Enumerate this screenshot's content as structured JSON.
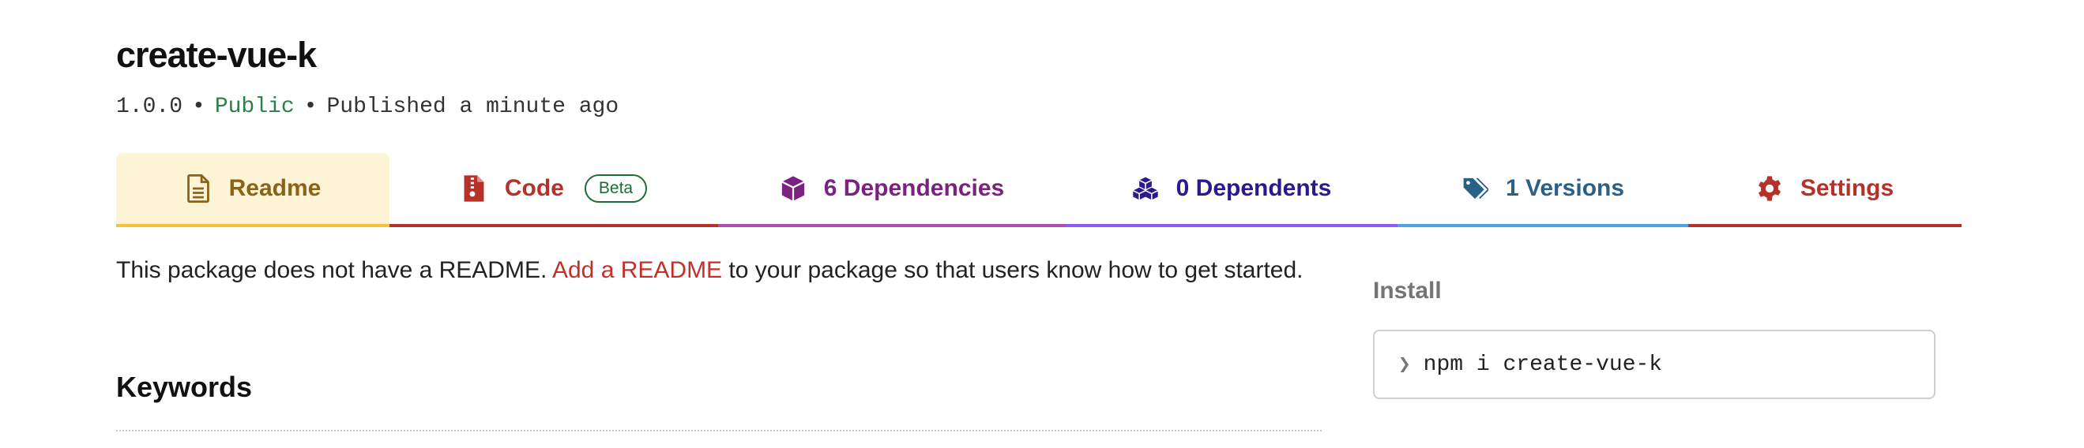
{
  "package": {
    "name": "create-vue-k",
    "version": "1.0.0",
    "separator": "•",
    "visibility": "Public",
    "published": "Published a minute ago"
  },
  "tabs": [
    {
      "label": "Readme",
      "icon": "file-icon",
      "active": true
    },
    {
      "label": "Code",
      "icon": "zip-file-icon",
      "badge": "Beta"
    },
    {
      "label": "6 Dependencies",
      "icon": "box-icon"
    },
    {
      "label": "0 Dependents",
      "icon": "cubes-icon"
    },
    {
      "label": "1 Versions",
      "icon": "tags-icon"
    },
    {
      "label": "Settings",
      "icon": "gear-icon"
    }
  ],
  "readme": {
    "prefix": "This package does not have a README.",
    "link": "Add a README",
    "suffix": "to your package so that users know how to get started."
  },
  "keywords": {
    "heading": "Keywords"
  },
  "install": {
    "label": "Install",
    "prompt": "❯",
    "command": "npm i create-vue-k"
  },
  "colors": {
    "public": "#2e7d4a",
    "readme_tab": "#f4c33a",
    "code_tab": "#b5322b",
    "deps_tab": "#b24bb8",
    "dependents_tab": "#8b5cf6",
    "versions_tab": "#4da4e4",
    "settings_tab": "#b5322b",
    "link": "#c2302b"
  }
}
